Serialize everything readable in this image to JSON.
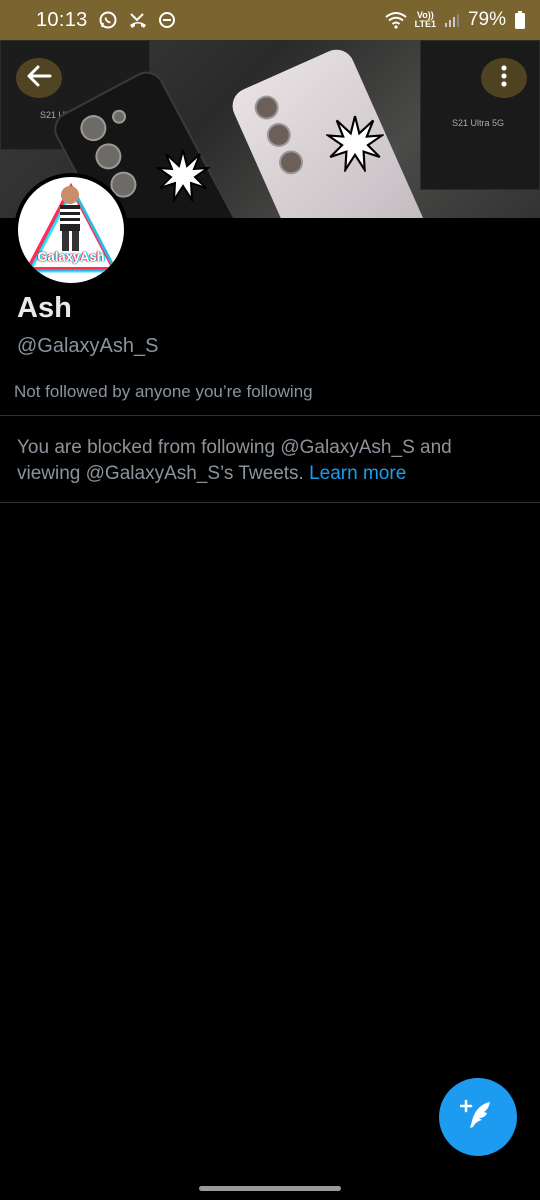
{
  "status_bar": {
    "time": "10:13",
    "battery": "79%",
    "network": "LTE1",
    "volte": "Vo))"
  },
  "banner": {
    "box_label_left": "S21 Ultra 5G",
    "box_label_right": "S21 Ultra 5G"
  },
  "avatar": {
    "name_on_image": "GalaxyAsh"
  },
  "profile": {
    "name": "Ash",
    "handle": "@GalaxyAsh_S",
    "followed_by": "Not followed by anyone you’re following"
  },
  "blocked_notice": {
    "text": "You are blocked from following @GalaxyAsh_S and viewing @GalaxyAsh_S’s Tweets.",
    "link": "Learn more"
  },
  "colors": {
    "accent": "#1d9bf0",
    "status_bar": "#7a6530",
    "background": "#000000",
    "secondary_text": "#8b949c"
  },
  "icons": [
    "whatsapp-icon",
    "missed-call-icon",
    "do-not-disturb-icon",
    "wifi-icon",
    "signal-icon",
    "battery-icon",
    "back-arrow-icon",
    "more-vertical-icon",
    "compose-tweet-icon"
  ]
}
